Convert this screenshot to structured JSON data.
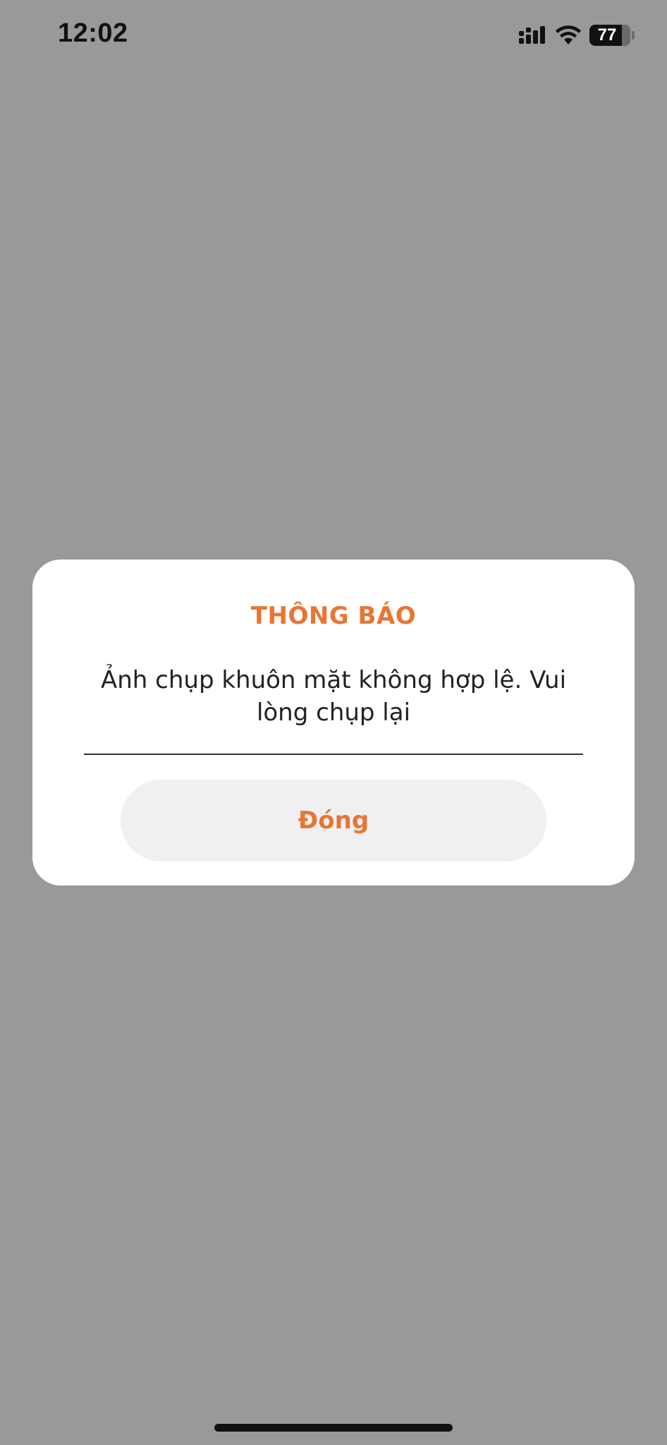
{
  "status_bar": {
    "time": "12:02",
    "battery_level": "77",
    "icons": [
      "signal-icon",
      "wifi-icon",
      "battery-icon"
    ]
  },
  "dialog": {
    "title": "THÔNG BÁO",
    "message": "Ảnh chụp khuôn mặt không hợp lệ. Vui lòng chụp lại",
    "close_label": "Đóng"
  },
  "colors": {
    "accent": "#e87535",
    "overlay": "#999999",
    "dialog_background": "#ffffff",
    "button_background": "#f0f0f2"
  }
}
